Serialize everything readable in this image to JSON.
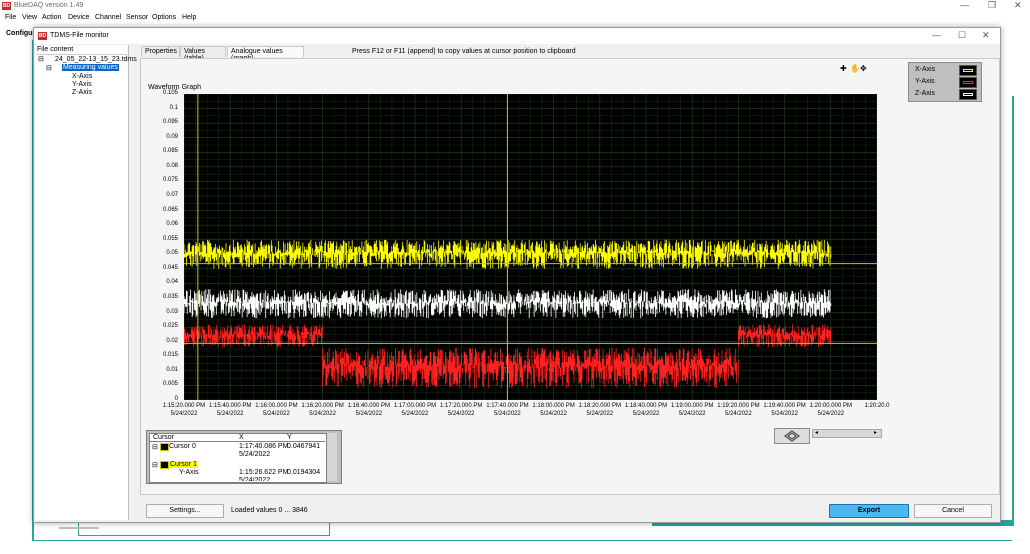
{
  "app": {
    "title": "BlueDAQ version 1.49",
    "logo_text": "BD",
    "menu": [
      "File",
      "View",
      "Action",
      "Device",
      "Channel",
      "Sensor",
      "Options",
      "Help"
    ],
    "config_label": "Configur"
  },
  "dialog": {
    "title": "TDMS-File monitor",
    "file_panel_header": "File content",
    "tree": {
      "file": "24_05_22-13_15_23.tdms",
      "group": "Measuring values",
      "channels": [
        "X-Axis",
        "Y-Axis",
        "Z-Axis"
      ]
    },
    "tabs": [
      "Properties",
      "Values (table)",
      "Analogue values (graph)"
    ],
    "active_tab": 2,
    "hint": "Press F12 or F11 (append) to copy values at cursor position to clipboard",
    "graph": {
      "label": "Waveform Graph"
    },
    "legend": [
      {
        "name": "X-Axis",
        "color": "#ffff00"
      },
      {
        "name": "Y-Axis",
        "color": "#ff2020"
      },
      {
        "name": "Z-Axis",
        "color": "#ffffff"
      }
    ],
    "cursor_table": {
      "headers": [
        "Cursor",
        "X",
        "Y"
      ],
      "rows": [
        {
          "name": "Cursor 0",
          "x": "1:17:40.086 PM",
          "x2": "5/24/2022",
          "y": "0.0467941"
        },
        {
          "name": "Cursor 1",
          "x": "",
          "x2": "",
          "y": ""
        },
        {
          "name": "Y-Axis",
          "x": "1:15:26.622 PM",
          "x2": "5/24/2022",
          "y": "0.0194304"
        }
      ]
    },
    "buttons": {
      "settings": "Settings...",
      "export": "Export",
      "cancel": "Cancel"
    },
    "status": "Loaded values 0 ... 3846"
  },
  "chart_data": {
    "type": "line",
    "title": "Waveform Graph",
    "xlabel": "",
    "ylabel": "",
    "ylim": [
      0,
      0.105
    ],
    "y_ticks": [
      "0.105",
      "0.1",
      "0.095",
      "0.09",
      "0.085",
      "0.08",
      "0.075",
      "0.07",
      "0.065",
      "0.06",
      "0.055",
      "0.05",
      "0.045",
      "0.04",
      "0.035",
      "0.03",
      "0.025",
      "0.02",
      "0.015",
      "0.01",
      "0.005",
      "0"
    ],
    "x_ticks": [
      [
        "1:15:20.000 PM",
        "5/24/2022"
      ],
      [
        "1:15:40.000 PM",
        "5/24/2022"
      ],
      [
        "1:16:00.000 PM",
        "5/24/2022"
      ],
      [
        "1:16:20.000 PM",
        "5/24/2022"
      ],
      [
        "1:16:40.000 PM",
        "5/24/2022"
      ],
      [
        "1:17:00.000 PM",
        "5/24/2022"
      ],
      [
        "1:17:20.000 PM",
        "5/24/2022"
      ],
      [
        "1:17:40.000 PM",
        "5/24/2022"
      ],
      [
        "1:18:00.000 PM",
        "5/24/2022"
      ],
      [
        "1:18:20.000 PM",
        "5/24/2022"
      ],
      [
        "1:18:40.000 PM",
        "5/24/2022"
      ],
      [
        "1:19:00.000 PM",
        "5/24/2022"
      ],
      [
        "1:19:20.000 PM",
        "5/24/2022"
      ],
      [
        "1:19:40.000 PM",
        "5/24/2022"
      ],
      [
        "1:20:00.000 PM",
        "5/24/2022"
      ],
      [
        "1:20:20.0",
        ""
      ]
    ],
    "xlim_seconds_range": [
      0,
      300
    ],
    "grid": true,
    "series": [
      {
        "name": "X-Axis",
        "color": "#ffff00",
        "band": [
          0.045,
          0.055
        ],
        "x_end": 280
      },
      {
        "name": "Z-Axis",
        "color": "#ffffff",
        "band": [
          0.028,
          0.038
        ],
        "x_end": 280
      },
      {
        "name": "Y-Axis",
        "color": "#ff2020",
        "segments": [
          {
            "x": [
              0,
              60
            ],
            "band": [
              0.018,
              0.026
            ]
          },
          {
            "x": [
              60,
              240
            ],
            "band": [
              0.004,
              0.018
            ]
          },
          {
            "x": [
              240,
              280
            ],
            "band": [
              0.018,
              0.026
            ]
          }
        ]
      }
    ],
    "cursors": [
      {
        "name": "Cursor 0",
        "x": 140,
        "y": 0.0467941,
        "color": "#c8c800"
      },
      {
        "name": "Cursor 1",
        "x": 6,
        "y": 0.0194304,
        "color": "#c8c800"
      }
    ]
  }
}
